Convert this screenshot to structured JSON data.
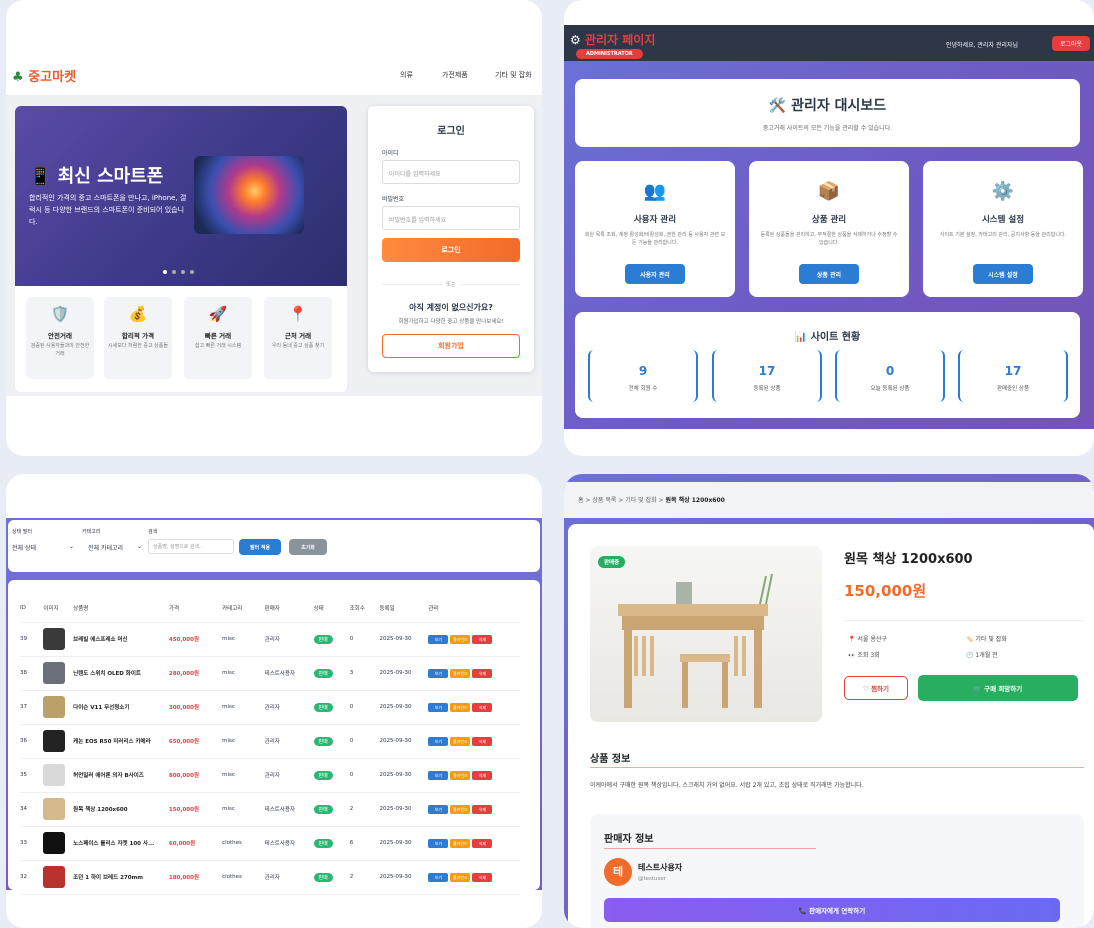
{
  "panel1": {
    "brand": "중고마켓",
    "nav": [
      "의류",
      "가전제품",
      "기타 및 잡화"
    ],
    "hero": {
      "title": "최신 스마트폰",
      "desc": "합리적인 가격의 중고 스마트폰을 만나고, iPhone, 갤럭시 등 다양한 브랜드의 스마트폰이 준비되어 있습니다."
    },
    "features": [
      {
        "icon": "🛡️",
        "title": "안전거래",
        "desc": "검증된 사용자들과의 안전한 거래"
      },
      {
        "icon": "💰",
        "title": "합리적 가격",
        "desc": "시세보다 저렴한 중고 상품들"
      },
      {
        "icon": "🚀",
        "title": "빠른 거래",
        "desc": "쉽고 빠른 거래 시스템"
      },
      {
        "icon": "📍",
        "title": "근처 거래",
        "desc": "우리 동네 중고 상품 찾기"
      }
    ],
    "login": {
      "title": "로그인",
      "id_label": "아이디",
      "id_placeholder": "아이디를 입력하세요",
      "pw_label": "비밀번호",
      "pw_placeholder": "비밀번호를 입력하세요",
      "submit": "로그인",
      "or": "또는",
      "no_account": "아직 계정이 없으신가요?",
      "signup_desc": "회원가입하고 다양한 중고 상품을 만나보세요!",
      "signup": "회원가입"
    }
  },
  "panel2": {
    "title": "관리자 페이지",
    "badge": "ADMINISTRATOR",
    "greeting": "안녕하세요, 관리자 관리자님",
    "logout": "로그아웃",
    "dashboard_title": "🛠️ 관리자 대시보드",
    "dashboard_desc": "중고거래 사이트의 모든 기능을 관리할 수 있습니다.",
    "cards": [
      {
        "icon": "👥",
        "title": "사용자 관리",
        "desc": "회원 목록 조회, 계정 활성화/비활성화, 권한 관리 등 사용자 관련 모든 기능을 관리합니다.",
        "button": "사용자 관리"
      },
      {
        "icon": "📦",
        "title": "상품 관리",
        "desc": "등록된 상품들을 관리하고, 부적절한 상품을 삭제하거나 수정할 수 있습니다.",
        "button": "상품 관리"
      },
      {
        "icon": "⚙️",
        "title": "시스템 설정",
        "desc": "사이트 기본 설정, 카테고리 관리, 공지사항 등을 관리합니다.",
        "button": "시스템 설정"
      }
    ],
    "stats_title": "📊 사이트 현황",
    "stats": [
      {
        "value": "9",
        "label": "전체 회원 수"
      },
      {
        "value": "17",
        "label": "등록된 상품"
      },
      {
        "value": "0",
        "label": "오늘 등록된 상품"
      },
      {
        "value": "17",
        "label": "판매중인 상품"
      }
    ]
  },
  "panel3": {
    "filters": {
      "status_label": "상태 필터",
      "status_value": "전체 상태",
      "category_label": "카테고리",
      "category_value": "전체 카테고리",
      "search_label": "검색",
      "search_placeholder": "상품명, 설명으로 검색...",
      "apply": "필터 적용",
      "reset": "초기화"
    },
    "columns": [
      "ID",
      "이미지",
      "상품명",
      "가격",
      "카테고리",
      "판매자",
      "상태",
      "조회수",
      "등록일",
      "관리"
    ],
    "actions": [
      "보기",
      "올라인드",
      "삭제"
    ],
    "rows": [
      {
        "id": "39",
        "name": "브레빌 에스프레소 머신",
        "price": "450,000원",
        "category": "misc",
        "seller": "관리자",
        "status": "판매",
        "views": "0",
        "date": "2025-09-30",
        "thumb": "#3a3a3a"
      },
      {
        "id": "38",
        "name": "닌텐도 스위치 OLED 화이트",
        "price": "280,000원",
        "category": "misc",
        "seller": "테스트사용자",
        "status": "판매",
        "views": "3",
        "date": "2025-09-30",
        "thumb": "#6a6f78"
      },
      {
        "id": "37",
        "name": "다이슨 V11 무선청소기",
        "price": "300,000원",
        "category": "misc",
        "seller": "관리자",
        "status": "판매",
        "views": "0",
        "date": "2025-09-30",
        "thumb": "#b9a26a"
      },
      {
        "id": "36",
        "name": "캐논 EOS R50 미러리스 카메라",
        "price": "650,000원",
        "category": "misc",
        "seller": "관리자",
        "status": "판매",
        "views": "0",
        "date": "2025-09-30",
        "thumb": "#222222"
      },
      {
        "id": "35",
        "name": "허먼밀러 에어론 의자 B사이즈",
        "price": "800,000원",
        "category": "misc",
        "seller": "관리자",
        "status": "판매",
        "views": "0",
        "date": "2025-09-30",
        "thumb": "#d9d9d9"
      },
      {
        "id": "34",
        "name": "원목 책상 1200x600",
        "price": "150,000원",
        "category": "misc",
        "seller": "테스트사용자",
        "status": "판매",
        "views": "2",
        "date": "2025-09-30",
        "thumb": "#d6b98a"
      },
      {
        "id": "33",
        "name": "노스페이스 롤리스 자켓 100 사...",
        "price": "60,000원",
        "category": "clothes",
        "seller": "테스트사용자",
        "status": "판매",
        "views": "6",
        "date": "2025-09-30",
        "thumb": "#111111"
      },
      {
        "id": "32",
        "name": "조던 1 하이 브레드 270mm",
        "price": "180,000원",
        "category": "clothes",
        "seller": "관리자",
        "status": "판매",
        "views": "2",
        "date": "2025-09-30",
        "thumb": "#b8322e"
      }
    ]
  },
  "panel4": {
    "breadcrumb": {
      "home": "홈",
      "list": "상품 목록",
      "category": "기타 및 잡화",
      "current": "원목 책상 1200x600"
    },
    "badge": "판매중",
    "title": "원목 책상 1200x600",
    "price": "150,000원",
    "meta": {
      "location": "서울 용산구",
      "category": "기타 및 잡화",
      "views": "조회 3회",
      "time": "1개월 전"
    },
    "like": "♡ 찜하기",
    "buy": "🛒 구매 희망하기",
    "info_title": "상품 정보",
    "info_desc": "이케아에서 구매한 원목 책상입니다. 스크래치 거의 없어요. 서랍 2개 있고, 조립 상태로 직거래만 가능합니다.",
    "seller_title": "판매자 정보",
    "seller_initial": "테",
    "seller_name": "테스트사용자",
    "seller_handle": "@testuser",
    "contact": "📞 판매자에게 연락하기"
  },
  "colors": {
    "accent_orange": "#ff7a2e",
    "admin_red": "#e53e3e",
    "stat_blue": "#2b7cd3",
    "green": "#27ae60"
  }
}
